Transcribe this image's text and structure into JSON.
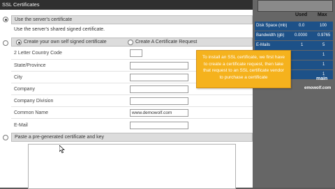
{
  "section": {
    "title": "SSL Certificates"
  },
  "options": {
    "use_server_cert": "Use the server's certificate",
    "use_shared_cert": "Use the server's shared signed certificate.",
    "create_self_signed": "Create your own self signed certificate",
    "create_request": "Create A Certificate Request",
    "paste_cert": "Paste a pre-generated certificate and key"
  },
  "form": {
    "country_code": {
      "label": "2 Letter Country Code",
      "value": ""
    },
    "state": {
      "label": "State/Province",
      "value": ""
    },
    "city": {
      "label": "City",
      "value": ""
    },
    "company": {
      "label": "Company",
      "value": ""
    },
    "division": {
      "label": "Company Division",
      "value": ""
    },
    "common_name": {
      "label": "Common Name",
      "value": "www.demowolf.com"
    },
    "email": {
      "label": "E-Mail",
      "value": ""
    }
  },
  "stats": {
    "headers": {
      "used": "Used",
      "max": "Max"
    },
    "rows": [
      {
        "label": "Disk Space (mb)",
        "used": "0.0",
        "max": "100"
      },
      {
        "label": "Bandwidth (gb)",
        "used": "0.0000",
        "max": "0.9765"
      },
      {
        "label": "E-Mails",
        "used": "1",
        "max": "5"
      },
      {
        "label": "",
        "used": "",
        "max": "1"
      },
      {
        "label": "",
        "used": "",
        "max": "1"
      },
      {
        "label": "",
        "used": "",
        "max": "1"
      }
    ]
  },
  "tooltip": {
    "text": "To install an SSL certificate, we first have to create a certificate request, then take that request to an SSL certificate vendor to purchase a certificate"
  },
  "sidebar_fragments": {
    "domain": "main",
    "site": "emowolf.com"
  },
  "colors": {
    "header": "#2f2f2f",
    "stats_bar": "#1d5188",
    "tooltip": "#f5b21d",
    "sidebar": "#666666"
  }
}
